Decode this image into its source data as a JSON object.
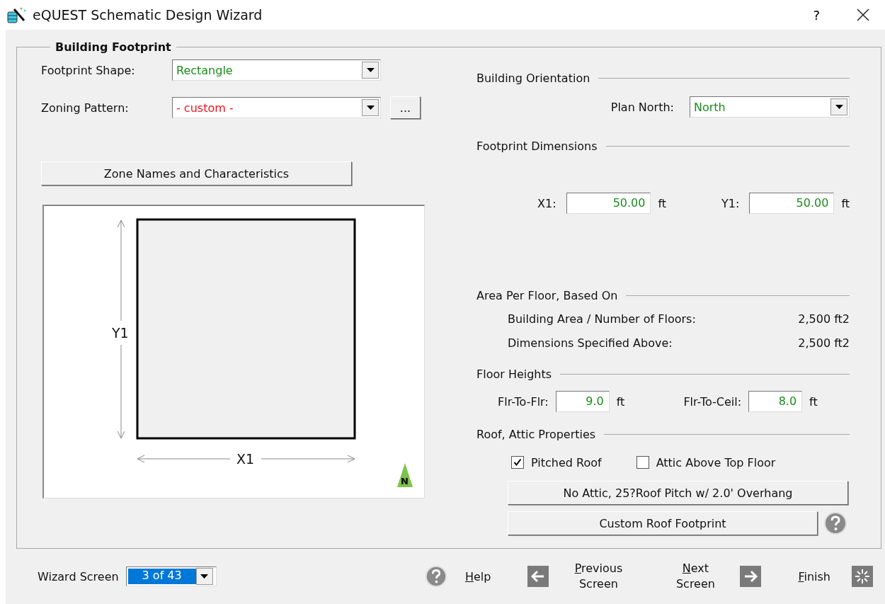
{
  "window": {
    "title": "eQUEST Schematic Design Wizard",
    "help": "?"
  },
  "group": {
    "title": "Building Footprint"
  },
  "footprint_shape": {
    "label": "Footprint Shape:",
    "value": "Rectangle",
    "is_custom": false
  },
  "zoning_pattern": {
    "label": "Zoning Pattern:",
    "value": "- custom -",
    "is_custom": true,
    "more": "..."
  },
  "zone_button": "Zone Names and Characteristics",
  "diagram": {
    "y_label": "Y1",
    "x_label": "X1",
    "north": "N"
  },
  "orientation": {
    "heading": "Building Orientation",
    "label": "Plan North:",
    "value": "North"
  },
  "dimensions": {
    "heading": "Footprint Dimensions",
    "fields": [
      {
        "label": "X1:",
        "value": "50.00",
        "unit": "ft"
      },
      {
        "label": "Y1:",
        "value": "50.00",
        "unit": "ft"
      }
    ]
  },
  "area": {
    "heading": "Area Per Floor, Based On",
    "rows": [
      {
        "label": "Building Area / Number of Floors:",
        "value": "2,500 ft2"
      },
      {
        "label": "Dimensions Specified Above:",
        "value": "2,500 ft2"
      }
    ]
  },
  "heights": {
    "heading": "Floor Heights",
    "fields": [
      {
        "label": "Flr-To-Flr:",
        "value": "9.0",
        "unit": "ft"
      },
      {
        "label": "Flr-To-Ceil:",
        "value": "8.0",
        "unit": "ft"
      }
    ]
  },
  "roof": {
    "heading": "Roof, Attic Properties",
    "checkboxes": [
      {
        "label": "Pitched Roof",
        "checked": true
      },
      {
        "label": "Attic Above Top Floor",
        "checked": false
      }
    ],
    "roof_button": "No Attic, 25?Roof Pitch w/ 2.0' Overhang",
    "custom_button": "Custom Roof Footprint"
  },
  "footer": {
    "screen_label": "Wizard Screen",
    "screen_value": "3 of 43",
    "nav": [
      {
        "kind": "help",
        "label": "Help"
      },
      {
        "kind": "previous",
        "label": "Previous Screen"
      },
      {
        "kind": "next",
        "label": "Next Screen"
      },
      {
        "kind": "finish",
        "label": "Finish"
      }
    ]
  }
}
